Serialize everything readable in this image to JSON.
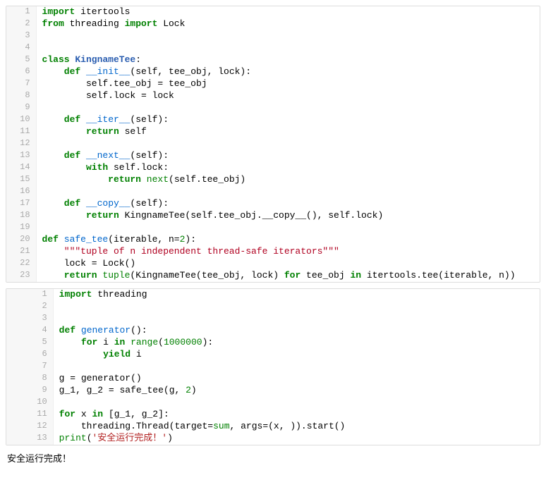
{
  "blocks": [
    {
      "lines": [
        [
          {
            "t": "import",
            "c": "k"
          },
          {
            "t": " itertools",
            "c": "n"
          }
        ],
        [
          {
            "t": "from",
            "c": "k"
          },
          {
            "t": " threading ",
            "c": "n"
          },
          {
            "t": "import",
            "c": "k"
          },
          {
            "t": " Lock",
            "c": "n"
          }
        ],
        [],
        [],
        [
          {
            "t": "class",
            "c": "k"
          },
          {
            "t": " ",
            "c": "n"
          },
          {
            "t": "KingnameTee",
            "c": "cls"
          },
          {
            "t": ":",
            "c": "p"
          }
        ],
        [
          {
            "t": "    ",
            "c": "n"
          },
          {
            "t": "def",
            "c": "k"
          },
          {
            "t": " ",
            "c": "n"
          },
          {
            "t": "__init__",
            "c": "nd"
          },
          {
            "t": "(self, tee_obj, lock):",
            "c": "n"
          }
        ],
        [
          {
            "t": "        self.tee_obj = tee_obj",
            "c": "n"
          }
        ],
        [
          {
            "t": "        self.lock = lock",
            "c": "n"
          }
        ],
        [],
        [
          {
            "t": "    ",
            "c": "n"
          },
          {
            "t": "def",
            "c": "k"
          },
          {
            "t": " ",
            "c": "n"
          },
          {
            "t": "__iter__",
            "c": "nd"
          },
          {
            "t": "(self):",
            "c": "n"
          }
        ],
        [
          {
            "t": "        ",
            "c": "n"
          },
          {
            "t": "return",
            "c": "k"
          },
          {
            "t": " self",
            "c": "n"
          }
        ],
        [],
        [
          {
            "t": "    ",
            "c": "n"
          },
          {
            "t": "def",
            "c": "k"
          },
          {
            "t": " ",
            "c": "n"
          },
          {
            "t": "__next__",
            "c": "nd"
          },
          {
            "t": "(self):",
            "c": "n"
          }
        ],
        [
          {
            "t": "        ",
            "c": "n"
          },
          {
            "t": "with",
            "c": "k"
          },
          {
            "t": " self.lock:",
            "c": "n"
          }
        ],
        [
          {
            "t": "            ",
            "c": "n"
          },
          {
            "t": "return",
            "c": "k"
          },
          {
            "t": " ",
            "c": "n"
          },
          {
            "t": "next",
            "c": "bi"
          },
          {
            "t": "(self.tee_obj)",
            "c": "n"
          }
        ],
        [],
        [
          {
            "t": "    ",
            "c": "n"
          },
          {
            "t": "def",
            "c": "k"
          },
          {
            "t": " ",
            "c": "n"
          },
          {
            "t": "__copy__",
            "c": "nd"
          },
          {
            "t": "(self):",
            "c": "n"
          }
        ],
        [
          {
            "t": "        ",
            "c": "n"
          },
          {
            "t": "return",
            "c": "k"
          },
          {
            "t": " KingnameTee(self.tee_obj.__copy__(), self.lock)",
            "c": "n"
          }
        ],
        [],
        [
          {
            "t": "def",
            "c": "k"
          },
          {
            "t": " ",
            "c": "n"
          },
          {
            "t": "safe_tee",
            "c": "nd"
          },
          {
            "t": "(iterable, n=",
            "c": "n"
          },
          {
            "t": "2",
            "c": "nu"
          },
          {
            "t": "):",
            "c": "n"
          }
        ],
        [
          {
            "t": "    ",
            "c": "n"
          },
          {
            "t": "\"\"\"tuple of n independent thread-safe iterators\"\"\"",
            "c": "ds"
          }
        ],
        [
          {
            "t": "    lock = Lock()",
            "c": "n"
          }
        ],
        [
          {
            "t": "    ",
            "c": "n"
          },
          {
            "t": "return",
            "c": "k"
          },
          {
            "t": " ",
            "c": "n"
          },
          {
            "t": "tuple",
            "c": "bi"
          },
          {
            "t": "(KingnameTee(tee_obj, lock) ",
            "c": "n"
          },
          {
            "t": "for",
            "c": "k"
          },
          {
            "t": " tee_obj ",
            "c": "n"
          },
          {
            "t": "in",
            "c": "k"
          },
          {
            "t": " itertools.tee(iterable, n))",
            "c": "n"
          }
        ]
      ]
    },
    {
      "lines": [
        [
          {
            "t": "import",
            "c": "k"
          },
          {
            "t": " threading",
            "c": "n"
          }
        ],
        [],
        [],
        [
          {
            "t": "def",
            "c": "k"
          },
          {
            "t": " ",
            "c": "n"
          },
          {
            "t": "generator",
            "c": "nd"
          },
          {
            "t": "():",
            "c": "n"
          }
        ],
        [
          {
            "t": "    ",
            "c": "n"
          },
          {
            "t": "for",
            "c": "k"
          },
          {
            "t": " i ",
            "c": "n"
          },
          {
            "t": "in",
            "c": "k"
          },
          {
            "t": " ",
            "c": "n"
          },
          {
            "t": "range",
            "c": "bi"
          },
          {
            "t": "(",
            "c": "n"
          },
          {
            "t": "1000000",
            "c": "nu"
          },
          {
            "t": "):",
            "c": "n"
          }
        ],
        [
          {
            "t": "        ",
            "c": "n"
          },
          {
            "t": "yield",
            "c": "k"
          },
          {
            "t": " i",
            "c": "n"
          }
        ],
        [],
        [
          {
            "t": "g = generator()",
            "c": "n"
          }
        ],
        [
          {
            "t": "g_1, g_2 = safe_tee(g, ",
            "c": "n"
          },
          {
            "t": "2",
            "c": "nu"
          },
          {
            "t": ")",
            "c": "n"
          }
        ],
        [],
        [
          {
            "t": "for",
            "c": "k"
          },
          {
            "t": " x ",
            "c": "n"
          },
          {
            "t": "in",
            "c": "k"
          },
          {
            "t": " [g_1, g_2]:",
            "c": "n"
          }
        ],
        [
          {
            "t": "    threading.Thread(target=",
            "c": "n"
          },
          {
            "t": "sum",
            "c": "bi"
          },
          {
            "t": ", args=(x, )).start()",
            "c": "n"
          }
        ],
        [
          {
            "t": "print",
            "c": "bi"
          },
          {
            "t": "(",
            "c": "n"
          },
          {
            "t": "'安全运行完成！'",
            "c": "s"
          },
          {
            "t": ")",
            "c": "n"
          }
        ]
      ]
    }
  ],
  "output": "安全运行完成！"
}
